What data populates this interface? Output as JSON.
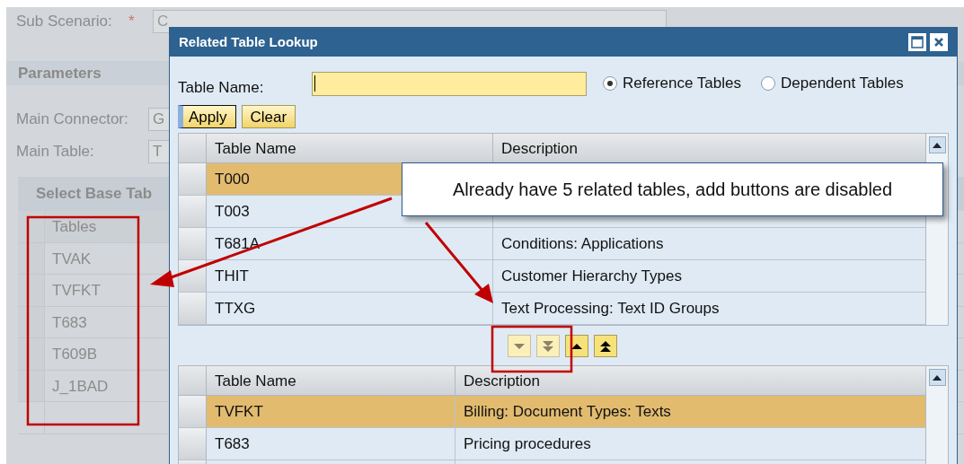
{
  "background": {
    "sub_scenario": {
      "label": "Sub Scenario:",
      "required_mark": "*",
      "value": "C"
    },
    "section_title": "Parameters",
    "fields": [
      {
        "label": "Main Connector:",
        "value": "G"
      },
      {
        "label": "Main Table:",
        "value": "T"
      }
    ],
    "panel_title": "Select Base Tab",
    "tables": {
      "column": "Tables",
      "rows": [
        "TVAK",
        "TVFKT",
        "T683",
        "T609B",
        "J_1BAD"
      ]
    }
  },
  "dialog": {
    "title": "Related Table Lookup",
    "table_name_label": "Table Name:",
    "radios": [
      {
        "label": "Reference Tables",
        "selected": true
      },
      {
        "label": "Dependent Tables",
        "selected": false
      }
    ],
    "buttons": [
      {
        "label": "Apply",
        "focused": true
      },
      {
        "label": "Clear",
        "focused": false
      }
    ],
    "upper_table": {
      "columns": [
        "Table Name",
        "Description"
      ],
      "rows": [
        {
          "name": "T000",
          "selected": true
        },
        {
          "name": "T003",
          "selected": false
        },
        {
          "name": "T681A",
          "description": "Conditions: Applications",
          "selected": false
        },
        {
          "name": "THIT",
          "description": "Customer Hierarchy Types",
          "selected": false
        },
        {
          "name": "TTXG",
          "description": "Text Processing: Text ID Groups",
          "selected": false
        }
      ]
    },
    "move_buttons": [
      {
        "kind": "down",
        "disabled": true
      },
      {
        "kind": "down_all",
        "disabled": true
      },
      {
        "kind": "up",
        "disabled": false
      },
      {
        "kind": "up_all",
        "disabled": false
      }
    ],
    "lower_table": {
      "columns": [
        "Table Name",
        "Description"
      ],
      "rows": [
        {
          "name": "TVFKT",
          "description": "Billing: Document Types: Texts",
          "selected": true
        },
        {
          "name": "T683",
          "description": "Pricing procedures",
          "selected": false
        }
      ]
    }
  },
  "annotation": {
    "callout": "Already have 5 related tables, add buttons are disabled"
  }
}
